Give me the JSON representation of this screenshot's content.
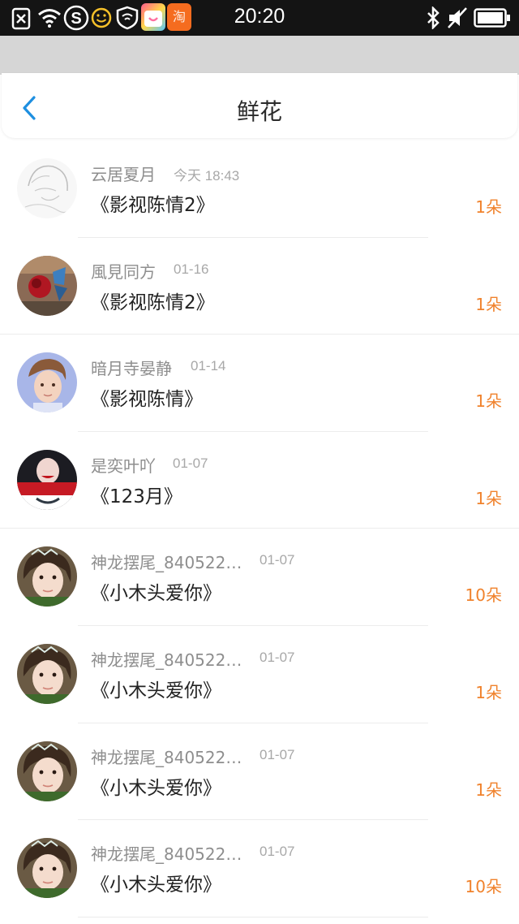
{
  "status_bar": {
    "time": "20:20",
    "left_icons": [
      "sim-off-icon",
      "wifi-icon",
      "s-app-icon",
      "smiley-icon",
      "shield-wifi-icon",
      "shopping-app-icon",
      "taobao-app-icon"
    ],
    "right_icons": [
      "bluetooth-icon",
      "mute-icon",
      "battery-icon"
    ],
    "taobao_glyph": "淘"
  },
  "header": {
    "title": "鲜花",
    "back_icon": "chevron-left-icon"
  },
  "colors": {
    "accent": "#1e8fe0",
    "count": "#f0822c"
  },
  "rows": [
    {
      "name": "云居夏月",
      "time": "今天 18:43",
      "work": "《影视陈情2》",
      "count": "1朵"
    },
    {
      "name": "風見同方",
      "time": "01-16",
      "work": "《影视陈情2》",
      "count": "1朵"
    },
    {
      "name": "暗月寺晏静",
      "time": "01-14",
      "work": "《影视陈情》",
      "count": "1朵"
    },
    {
      "name": "是奕叶吖",
      "time": "01-07",
      "work": "《123月》",
      "count": "1朵"
    },
    {
      "name": "神龙摆尾_840522…",
      "time": "01-07",
      "work": "《小木头爱你》",
      "count": "10朵"
    },
    {
      "name": "神龙摆尾_840522…",
      "time": "01-07",
      "work": "《小木头爱你》",
      "count": "1朵"
    },
    {
      "name": "神龙摆尾_840522…",
      "time": "01-07",
      "work": "《小木头爱你》",
      "count": "1朵"
    },
    {
      "name": "神龙摆尾_840522…",
      "time": "01-07",
      "work": "《小木头爱你》",
      "count": "10朵"
    }
  ]
}
